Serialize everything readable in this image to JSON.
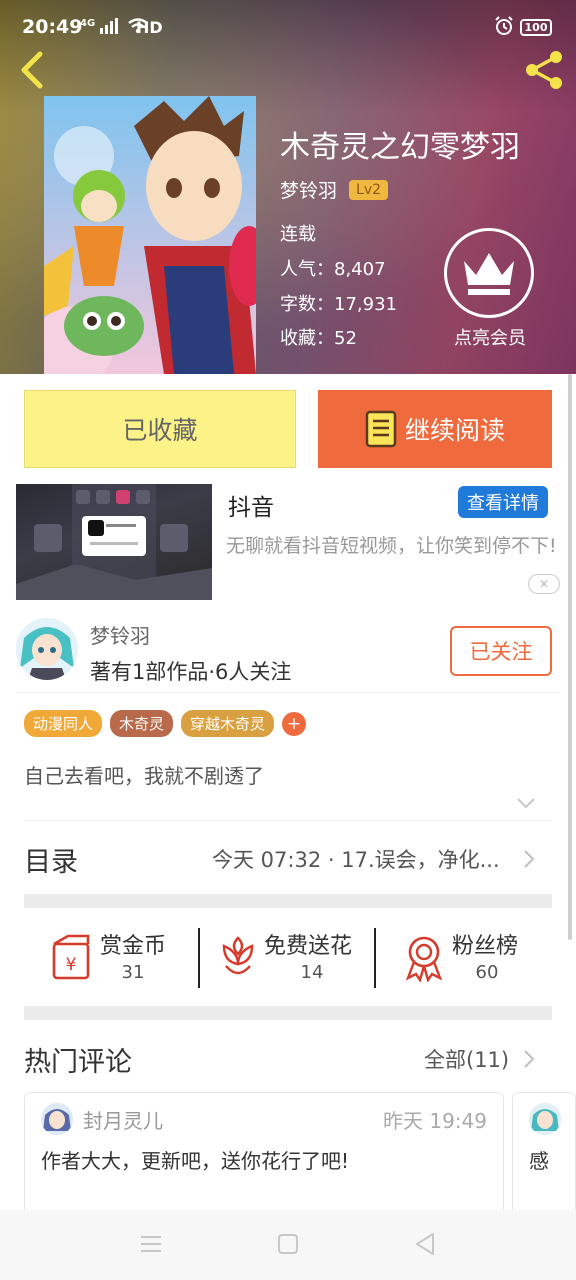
{
  "status_bar": {
    "time": "20:49",
    "network": "4G",
    "hd": "HD",
    "battery": "100"
  },
  "book": {
    "title": "木奇灵之幻零梦羽",
    "author": "梦铃羽",
    "level": "Lv2",
    "status": "连载",
    "popularity_label": "人气：",
    "popularity": "8,407",
    "words_label": "字数：",
    "words": "17,931",
    "favorites_label": "收藏：",
    "favorites": "52",
    "vip_label": "点亮会员"
  },
  "actions": {
    "favorited_label": "已收藏",
    "continue_label": "继续阅读"
  },
  "ad": {
    "title": "抖音",
    "detail_button": "查看详情",
    "description": "无聊就看抖音短视频，让你笑到停不下!",
    "close_icon": "close-icon"
  },
  "author_info": {
    "name": "梦铃羽",
    "stats": "著有1部作品·6人关注",
    "follow_label": "已关注"
  },
  "tags": [
    {
      "label": "动漫同人",
      "color": "#f0a838"
    },
    {
      "label": "木奇灵",
      "color": "#b86a4a"
    },
    {
      "label": "穿越木奇灵",
      "color": "#d8a040"
    }
  ],
  "synopsis": "自己去看吧，我就不剧透了",
  "catalog": {
    "label": "目录",
    "latest": "今天 07:32 · 17.误会，净化..."
  },
  "stats": [
    {
      "label": "赏金币",
      "count": "31",
      "icon": "red-envelope-icon"
    },
    {
      "label": "免费送花",
      "count": "14",
      "icon": "flower-icon"
    },
    {
      "label": "粉丝榜",
      "count": "60",
      "icon": "medal-icon"
    }
  ],
  "comments": {
    "label": "热门评论",
    "all_label": "全部(11)",
    "items": [
      {
        "user": "封月灵儿",
        "time": "昨天 19:49",
        "text": "作者大大，更新吧，送你花行了吧!"
      },
      {
        "user": "",
        "time": "",
        "text": "感"
      }
    ]
  },
  "colors": {
    "accent": "#ef6a3c",
    "favorite_bg": "#fbf288",
    "ad_button": "#1f7ad9",
    "level_badge": "#f1b840"
  }
}
